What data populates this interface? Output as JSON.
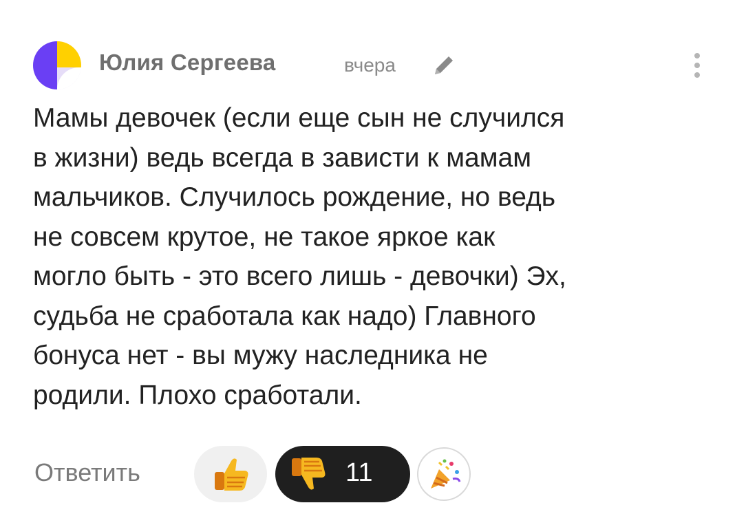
{
  "comment": {
    "author": "Юлия Сергеева",
    "time": "вчера",
    "text": "Мамы девочек (если еще сын не случился\nв жизни) ведь всегда в зависти к мамам\nмальчиков. Случилось рождение, но ведь\nне совсем крутое, не такое яркое как\nмогло быть - это всего лишь - девочки) Эх,\nсудьба не сработала как надо) Главного\nбонуса нет - вы мужу наследника не\nродили. Плохо сработали."
  },
  "actions": {
    "reply_label": "Ответить",
    "dislike_count": "11"
  },
  "icons": {
    "avatar": "avatar",
    "edit": "pencil-icon",
    "more": "more-vertical-icon",
    "like": "thumbs-up-icon",
    "dislike": "thumbs-down-icon",
    "party": "party-popper-icon"
  },
  "colors": {
    "dislike_bg": "#1f1f1f",
    "like_bg": "#f0f0f0",
    "thumb_yellow": "#f6b820",
    "avatar_purple": "#6a3ff4",
    "avatar_yellow": "#ffd000"
  }
}
